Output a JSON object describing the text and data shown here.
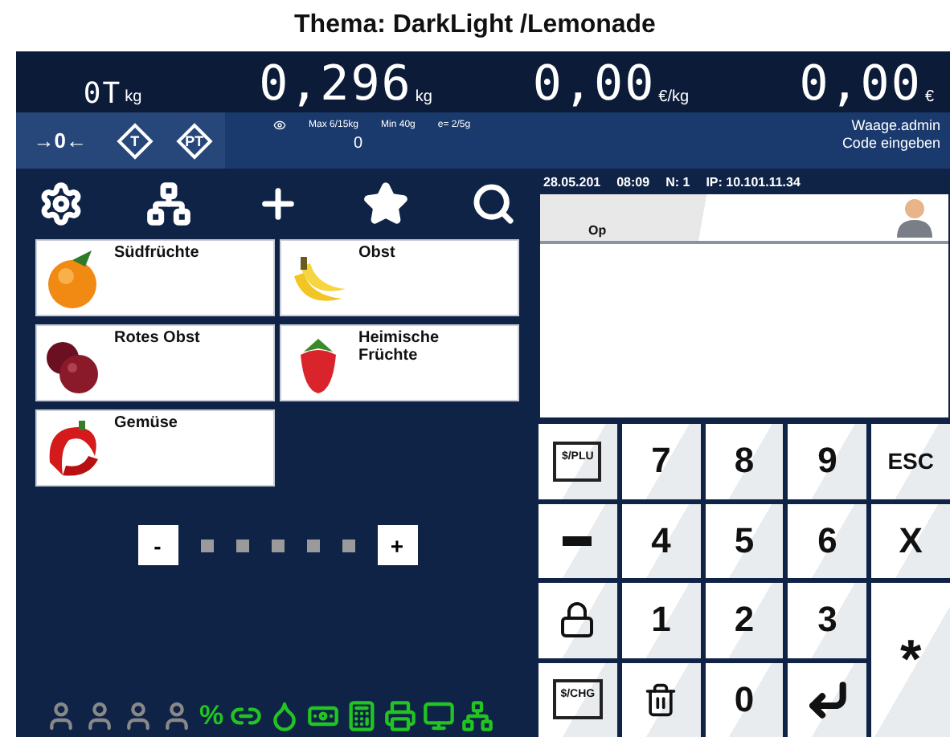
{
  "title": "Thema: DarkLight /Lemonade",
  "display": [
    {
      "value": "0T",
      "unit": "kg"
    },
    {
      "value": "0,296",
      "unit": "kg"
    },
    {
      "value": "0,00",
      "unit": "€/kg"
    },
    {
      "value": "0,00",
      "unit": "€"
    }
  ],
  "scale_keys": [
    {
      "label": "→0←",
      "kind": "plain"
    },
    {
      "label": "T",
      "kind": "diamond"
    },
    {
      "label": "PT",
      "kind": "diamond"
    }
  ],
  "scale_info": {
    "max": "Max 6/15kg",
    "min": "Min 40g",
    "e": "e= 2/5g",
    "value": "0",
    "user": "Waage.admin",
    "prompt": "Code eingeben"
  },
  "toolbar": [
    {
      "kind": "settings"
    },
    {
      "kind": "network"
    },
    {
      "kind": "add"
    },
    {
      "kind": "favorite"
    },
    {
      "kind": "search"
    }
  ],
  "categories": [
    {
      "label": "Südfrüchte"
    },
    {
      "label": "Obst"
    },
    {
      "label": "Rotes Obst"
    },
    {
      "label": "Heimische Früchte"
    },
    {
      "label": "Gemüse"
    }
  ],
  "pager": {
    "prev": "-",
    "next": "+"
  },
  "status_icons": [
    {
      "kind": "person",
      "active": false
    },
    {
      "kind": "person",
      "active": false
    },
    {
      "kind": "person",
      "active": false
    },
    {
      "kind": "person",
      "active": false
    },
    {
      "kind": "text",
      "label": "%",
      "active": true
    },
    {
      "kind": "link",
      "active": true
    },
    {
      "kind": "drop",
      "active": true
    },
    {
      "kind": "cash",
      "active": true
    },
    {
      "kind": "register",
      "active": true
    },
    {
      "kind": "printer",
      "active": true
    },
    {
      "kind": "monitor",
      "active": true
    },
    {
      "kind": "network",
      "active": true
    }
  ],
  "status_line": {
    "date": "28.05.201",
    "time": "08:09",
    "n": "N: 1",
    "ip": "IP: 10.101.11.34"
  },
  "operator": {
    "label": "Op"
  },
  "keypad": [
    {
      "kind": "icon",
      "label": "$/PLU"
    },
    {
      "kind": "text",
      "label": "7"
    },
    {
      "kind": "text",
      "label": "8"
    },
    {
      "kind": "text",
      "label": "9"
    },
    {
      "kind": "small",
      "label": "ESC"
    },
    {
      "kind": "minus"
    },
    {
      "kind": "text",
      "label": "4"
    },
    {
      "kind": "text",
      "label": "5"
    },
    {
      "kind": "text",
      "label": "6"
    },
    {
      "kind": "text",
      "label": "X"
    },
    {
      "kind": "lock"
    },
    {
      "kind": "text",
      "label": "1"
    },
    {
      "kind": "text",
      "label": "2"
    },
    {
      "kind": "text",
      "label": "3"
    },
    {
      "kind": "tall",
      "label": "*"
    },
    {
      "kind": "icon",
      "label": "$/CHG"
    },
    {
      "kind": "trash"
    },
    {
      "kind": "text",
      "label": "0"
    },
    {
      "kind": "enter"
    }
  ]
}
